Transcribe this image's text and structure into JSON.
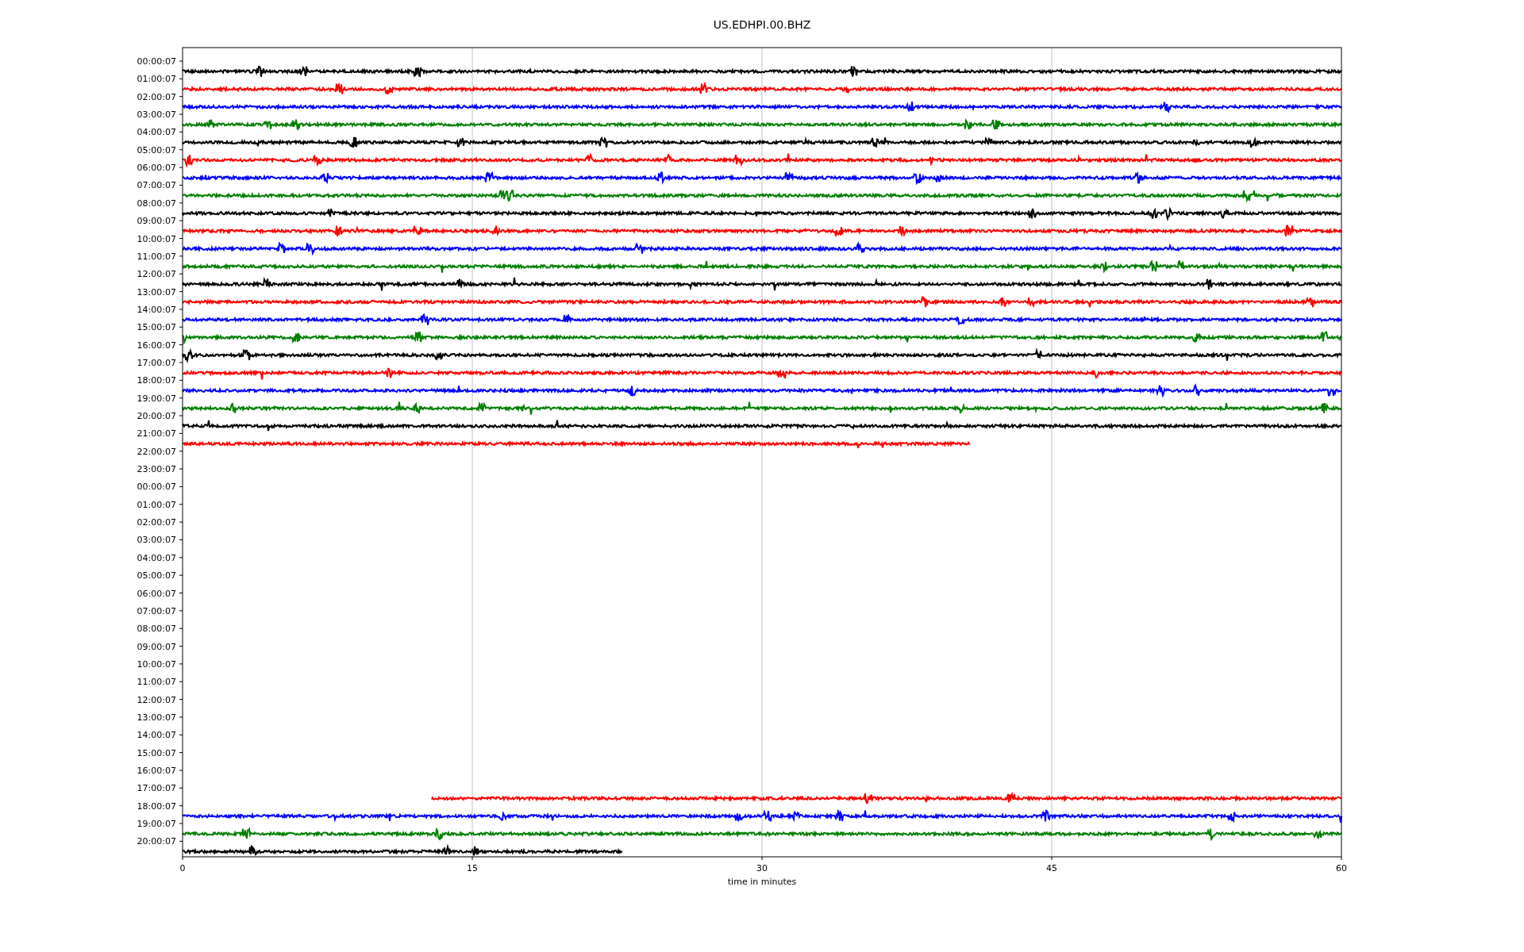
{
  "plot": {
    "title": "US.EDHPI.00.BHZ",
    "xlabel": "time in minutes",
    "xticks": [
      "0",
      "15",
      "30",
      "45",
      "60"
    ],
    "rows": [
      {
        "label": "00:00:07",
        "trace": {
          "color": "#000000",
          "kind": "from-start",
          "level": 1
        }
      },
      {
        "label": "01:00:07",
        "trace": {
          "color": "#ff0000",
          "kind": "from-start",
          "level": 1
        }
      },
      {
        "label": "02:00:07",
        "trace": {
          "color": "#0000ff",
          "kind": "from-start",
          "level": 1
        }
      },
      {
        "label": "03:00:07",
        "trace": {
          "color": "#008000",
          "kind": "from-start",
          "level": 1
        }
      },
      {
        "label": "04:00:07",
        "trace": {
          "color": "#000000",
          "kind": "from-start",
          "level": 1
        }
      },
      {
        "label": "05:00:07",
        "trace": {
          "color": "#ff0000",
          "kind": "from-start",
          "level": 1
        }
      },
      {
        "label": "06:00:07",
        "trace": {
          "color": "#0000ff",
          "kind": "from-start",
          "level": 1
        }
      },
      {
        "label": "07:00:07",
        "trace": {
          "color": "#008000",
          "kind": "from-start",
          "level": 1
        }
      },
      {
        "label": "08:00:07",
        "trace": {
          "color": "#000000",
          "kind": "from-start",
          "level": 1
        }
      },
      {
        "label": "09:00:07",
        "trace": {
          "color": "#ff0000",
          "kind": "from-start",
          "level": 1
        }
      },
      {
        "label": "10:00:07",
        "trace": {
          "color": "#0000ff",
          "kind": "from-start",
          "level": 1
        }
      },
      {
        "label": "11:00:07",
        "trace": {
          "color": "#008000",
          "kind": "from-start",
          "level": 1
        }
      },
      {
        "label": "12:00:07",
        "trace": {
          "color": "#000000",
          "kind": "from-start",
          "level": 1
        }
      },
      {
        "label": "13:00:07",
        "trace": {
          "color": "#ff0000",
          "kind": "from-start",
          "level": 1
        }
      },
      {
        "label": "14:00:07",
        "trace": {
          "color": "#0000ff",
          "kind": "from-start",
          "level": 1
        }
      },
      {
        "label": "15:00:07",
        "trace": {
          "color": "#008000",
          "kind": "from-start",
          "level": 1
        }
      },
      {
        "label": "16:00:07",
        "trace": {
          "color": "#000000",
          "kind": "from-start",
          "level": 1
        }
      },
      {
        "label": "17:00:07",
        "trace": {
          "color": "#ff0000",
          "kind": "from-start",
          "level": 1
        }
      },
      {
        "label": "18:00:07",
        "trace": {
          "color": "#0000ff",
          "kind": "from-start",
          "level": 1
        }
      },
      {
        "label": "19:00:07",
        "trace": {
          "color": "#008000",
          "kind": "from-start",
          "level": 1
        }
      },
      {
        "label": "20:00:07",
        "trace": {
          "color": "#000000",
          "kind": "from-start",
          "level": 1
        }
      },
      {
        "label": "21:00:07",
        "trace": {
          "color": "#ff0000",
          "kind": "from-start",
          "level": 0.68
        }
      },
      {
        "label": "22:00:07"
      },
      {
        "label": "23:00:07"
      },
      {
        "label": "00:00:07"
      },
      {
        "label": "01:00:07"
      },
      {
        "label": "02:00:07"
      },
      {
        "label": "03:00:07"
      },
      {
        "label": "04:00:07"
      },
      {
        "label": "05:00:07"
      },
      {
        "label": "06:00:07"
      },
      {
        "label": "07:00:07"
      },
      {
        "label": "08:00:07"
      },
      {
        "label": "09:00:07"
      },
      {
        "label": "10:00:07"
      },
      {
        "label": "11:00:07"
      },
      {
        "label": "12:00:07"
      },
      {
        "label": "13:00:07"
      },
      {
        "label": "14:00:07"
      },
      {
        "label": "15:00:07"
      },
      {
        "label": "16:00:07"
      },
      {
        "label": "17:00:07",
        "trace": {
          "color": "#ff0000",
          "kind": "to-end",
          "level": 0.785
        }
      },
      {
        "label": "18:00:07",
        "trace": {
          "color": "#0000ff",
          "kind": "from-start",
          "level": 1
        }
      },
      {
        "label": "19:00:07",
        "trace": {
          "color": "#008000",
          "kind": "from-start",
          "level": 1
        }
      },
      {
        "label": "20:00:07",
        "trace": {
          "color": "#000000",
          "kind": "from-start",
          "level": 0.38
        }
      }
    ]
  }
}
